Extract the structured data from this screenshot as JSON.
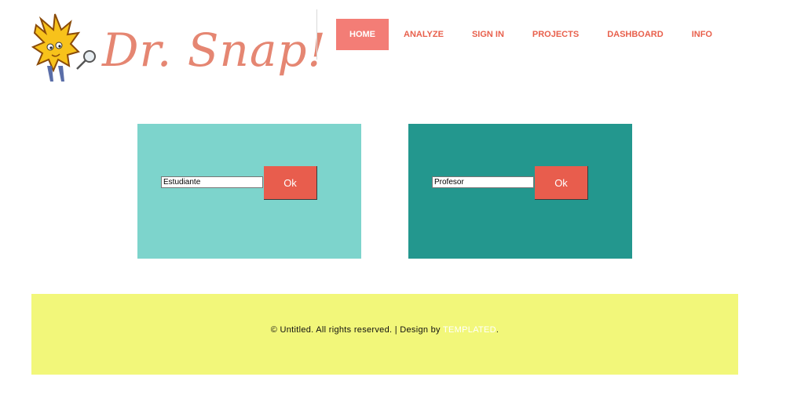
{
  "logo": {
    "text": "Dr. Snap!"
  },
  "nav": {
    "items": [
      {
        "label": "HOME"
      },
      {
        "label": "ANALYZE"
      },
      {
        "label": "SIGN IN"
      },
      {
        "label": "PROJECTS"
      },
      {
        "label": "DASHBOARD"
      },
      {
        "label": "INFO"
      }
    ]
  },
  "student": {
    "value": "Estudiante",
    "button": "Ok"
  },
  "teacher": {
    "value": "Profesor",
    "button": "Ok"
  },
  "footer": {
    "text": "© Untitled. All rights reserved. | Design by ",
    "link": "TEMPLATED",
    "suffix": "."
  },
  "colors": {
    "accent": "#e85d4d",
    "nav_active": "#f37d76",
    "student_panel": "#7dd4cc",
    "teacher_panel": "#23978e",
    "footer_bg": "#f2f77a",
    "logo_text": "#e58672"
  }
}
